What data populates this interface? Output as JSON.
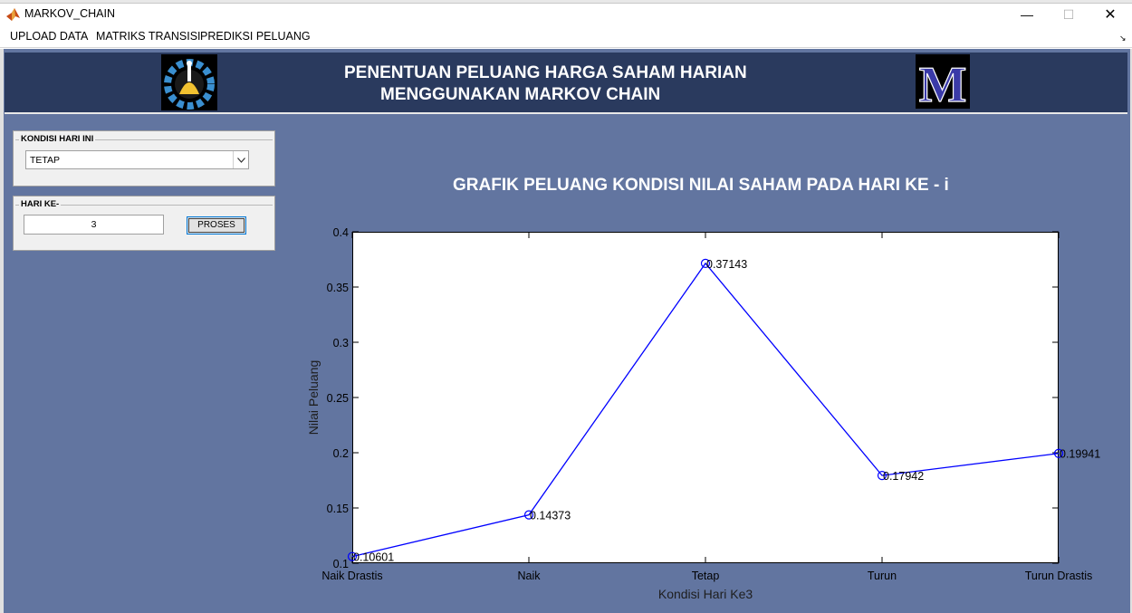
{
  "window": {
    "title": "MARKOV_CHAIN",
    "minimize": "—",
    "maximize": "☐",
    "close": "✕"
  },
  "menu": {
    "items": [
      "UPLOAD DATA",
      "MATRIKS TRANSISI",
      "PREDIKSI PELUANG"
    ],
    "dock_icon": "↘"
  },
  "header": {
    "title_line1": "PENENTUAN PELUANG HARGA SAHAM HARIAN",
    "title_line2": "MENGGUNAKAN MARKOV CHAIN",
    "logo_left": "its-logo-icon",
    "logo_right_letter": "M"
  },
  "panel_kondisi": {
    "title": "KONDISI HARI INI",
    "selected": "TETAP"
  },
  "panel_hari": {
    "title": "HARI KE-",
    "value": "3",
    "button": "PROSES"
  },
  "colors": {
    "figure_bg": "#6275a0",
    "header_band": "#2a3a5e",
    "line": "#0000ff"
  },
  "chart_data": {
    "type": "line",
    "title": "GRAFIK PELUANG KONDISI NILAI SAHAM PADA HARI KE - i",
    "xlabel": "Kondisi Hari Ke3",
    "ylabel": "Nilai Peluang",
    "categories": [
      "Naik Drastis",
      "Naik",
      "Tetap",
      "Turun",
      "Turun Drastis"
    ],
    "values": [
      0.10601,
      0.14373,
      0.37143,
      0.17942,
      0.19941
    ],
    "data_labels": [
      "0.10601",
      "0.14373",
      "0.37143",
      "0.17942",
      "0.19941"
    ],
    "ylim": [
      0.1,
      0.4
    ],
    "yticks": [
      0.1,
      0.15,
      0.2,
      0.25,
      0.3,
      0.35,
      0.4
    ],
    "ytick_labels": [
      "0.1",
      "0.15",
      "0.2",
      "0.25",
      "0.3",
      "0.35",
      "0.4"
    ],
    "marker": "circle",
    "grid": false
  }
}
